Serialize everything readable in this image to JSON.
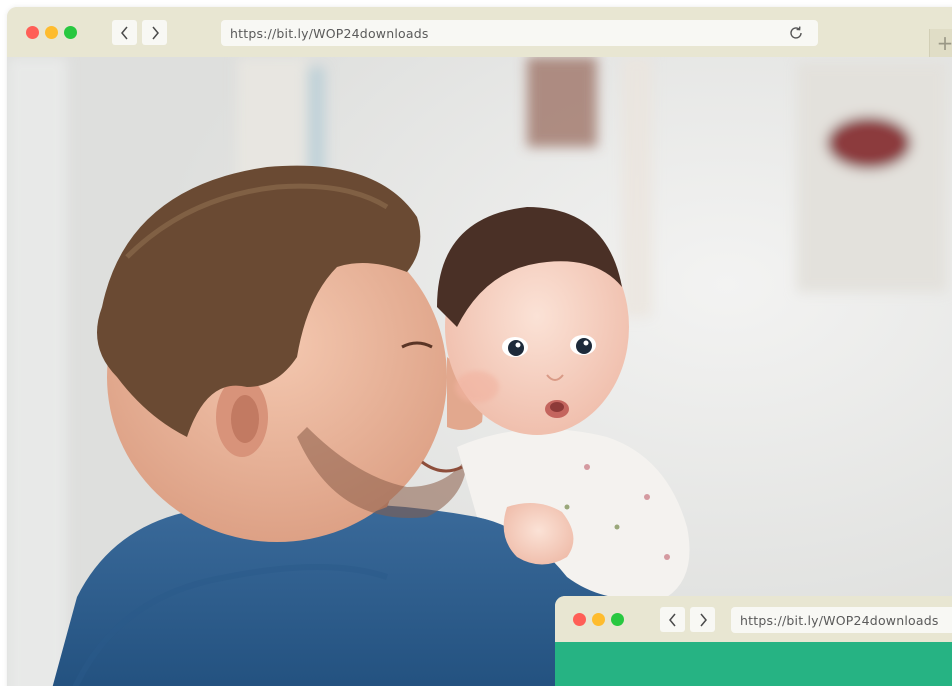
{
  "main_window": {
    "url": "https://bit.ly/WOP24downloads",
    "traffic_lights": [
      "close",
      "minimize",
      "maximize"
    ],
    "nav": {
      "back_icon": "chevron-left-icon",
      "forward_icon": "chevron-right-icon"
    },
    "reload_icon": "reload-icon",
    "new_tab_icon": "plus-icon",
    "toolbar_color": "#e8e6d2",
    "content": "photo of a smiling man holding a baby over his shoulder"
  },
  "secondary_window": {
    "url": "https://bit.ly/WOP24downloads",
    "content_color": "#26b383"
  },
  "colors": {
    "close": "#ff5f57",
    "minimize": "#febc2e",
    "maximize": "#28c840",
    "accent_green": "#26b383"
  }
}
